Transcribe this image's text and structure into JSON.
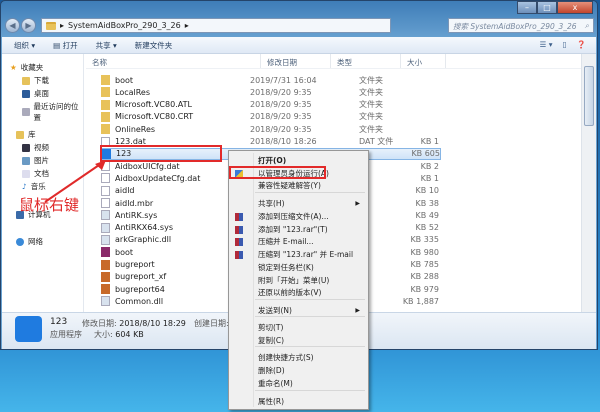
{
  "window": {
    "path": "SystemAidBoxPro_290_3_26",
    "search_placeholder": "搜索 SystemAidBoxPro_290_3_26",
    "min": "–",
    "max": "□",
    "close": "x"
  },
  "toolbar": {
    "organize": "组织 ▾",
    "open": "打开",
    "share": "共享 ▾",
    "new_folder": "新建文件夹"
  },
  "sidebar": {
    "favorites": "收藏夹",
    "downloads": "下载",
    "desktop": "桌面",
    "recent": "最近访问的位置",
    "libraries": "库",
    "videos": "视频",
    "pictures": "图片",
    "documents": "文档",
    "music": "音乐",
    "computer": "计算机",
    "network": "网络"
  },
  "columns": {
    "name": "名称",
    "date": "修改日期",
    "type": "类型",
    "size": "大小"
  },
  "files": [
    {
      "name": "boot",
      "date": "2019/7/31 16:04",
      "type": "文件夹",
      "size": "",
      "icon": "folder"
    },
    {
      "name": "LocalRes",
      "date": "2018/9/20 9:35",
      "type": "文件夹",
      "size": "",
      "icon": "folder"
    },
    {
      "name": "Microsoft.VC80.ATL",
      "date": "2018/9/20 9:35",
      "type": "文件夹",
      "size": "",
      "icon": "folder"
    },
    {
      "name": "Microsoft.VC80.CRT",
      "date": "2018/9/20 9:35",
      "type": "文件夹",
      "size": "",
      "icon": "folder"
    },
    {
      "name": "OnlineRes",
      "date": "2018/9/20 9:35",
      "type": "文件夹",
      "size": "",
      "icon": "folder"
    },
    {
      "name": "123.dat",
      "date": "2018/8/10 18:26",
      "type": "DAT 文件",
      "size": "1 KB",
      "icon": "file"
    },
    {
      "name": "123",
      "date": "",
      "type": "",
      "size": "605 KB",
      "icon": "app"
    },
    {
      "name": "AidboxUICfg.dat",
      "date": "",
      "type": "",
      "size": "2 KB",
      "icon": "file"
    },
    {
      "name": "AidboxUpdateCfg.dat",
      "date": "",
      "type": "",
      "size": "1 KB",
      "icon": "file"
    },
    {
      "name": "aidld",
      "date": "",
      "type": "",
      "size": "10 KB",
      "icon": "file"
    },
    {
      "name": "aidld.mbr",
      "date": "",
      "type": "",
      "size": "38 KB",
      "icon": "file"
    },
    {
      "name": "AntiRK.sys",
      "date": "",
      "type": "",
      "size": "49 KB",
      "icon": "sys"
    },
    {
      "name": "AntiRKX64.sys",
      "date": "",
      "type": "",
      "size": "52 KB",
      "icon": "sys"
    },
    {
      "name": "arkGraphic.dll",
      "date": "",
      "type": "",
      "size": "335 KB",
      "icon": "sys"
    },
    {
      "name": "boot",
      "date": "",
      "type": "",
      "size": "980 KB",
      "icon": "rar"
    },
    {
      "name": "bugreport",
      "date": "",
      "type": "",
      "size": "785 KB",
      "icon": "bug"
    },
    {
      "name": "bugreport_xf",
      "date": "",
      "type": "",
      "size": "288 KB",
      "icon": "bug"
    },
    {
      "name": "bugreport64",
      "date": "",
      "type": "",
      "size": "979 KB",
      "icon": "bug"
    },
    {
      "name": "Common.dll",
      "date": "",
      "type": "",
      "size": "1,887 KB",
      "icon": "sys"
    }
  ],
  "details": {
    "name": "123",
    "type": "应用程序",
    "modified_label": "修改日期:",
    "modified": "2018/8/10 18:29",
    "size_label": "大小:",
    "size": "604 KB",
    "created_label": "创建日期:"
  },
  "annotation": "鼠标右键",
  "menu": [
    {
      "label": "打开(O)",
      "bold": true
    },
    {
      "label": "以管理员身份运行(A)",
      "icon": "shield"
    },
    {
      "label": "兼容性疑难解答(Y)"
    },
    {
      "label": "共享(H)",
      "submenu": true
    },
    {
      "label": "添加到压缩文件(A)...",
      "icon": "rar"
    },
    {
      "label": "添加到 \"123.rar\"(T)",
      "icon": "rar"
    },
    {
      "label": "压缩并 E-mail...",
      "icon": "rar"
    },
    {
      "label": "压缩到 \"123.rar\" 并 E-mail",
      "icon": "rar"
    },
    {
      "label": "锁定到任务栏(K)"
    },
    {
      "label": "附到「开始」菜单(U)"
    },
    {
      "label": "还原以前的版本(V)"
    },
    {
      "label": "发送到(N)",
      "submenu": true
    },
    {
      "label": "剪切(T)"
    },
    {
      "label": "复制(C)"
    },
    {
      "label": "创建快捷方式(S)"
    },
    {
      "label": "删除(D)"
    },
    {
      "label": "重命名(M)"
    },
    {
      "label": "属性(R)"
    }
  ]
}
